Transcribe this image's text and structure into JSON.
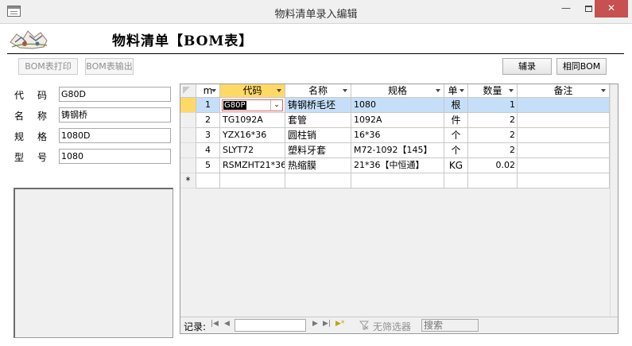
{
  "window": {
    "title": "物料清单录入编辑",
    "min_glyph": "—",
    "close_glyph": "✕"
  },
  "form": {
    "title": "物料清单【BOM表】"
  },
  "toolbar": {
    "print_label": "BOM表打印",
    "export_label": "BOM表输出",
    "assist_label": "辅录",
    "same_bom_label": "相同BOM"
  },
  "fields": [
    {
      "label": "代码",
      "value": "G80D"
    },
    {
      "label": "名称",
      "value": "铸钢桥"
    },
    {
      "label": "规格",
      "value": "1080D"
    },
    {
      "label": "型号",
      "value": "1080"
    }
  ],
  "grid": {
    "columns": [
      "m",
      "代码",
      "名称",
      "规格",
      "单",
      "数量",
      "备注"
    ],
    "rows": [
      {
        "n": "1",
        "code": "G80P",
        "name": "铸钢桥毛坯",
        "spec": "1080",
        "unit": "根",
        "qty": "1",
        "note": ""
      },
      {
        "n": "2",
        "code": "TG1092A",
        "name": "套管",
        "spec": "1092A",
        "unit": "件",
        "qty": "2",
        "note": ""
      },
      {
        "n": "3",
        "code": "YZX16*36",
        "name": "圆柱销",
        "spec": "16*36",
        "unit": "个",
        "qty": "2",
        "note": ""
      },
      {
        "n": "4",
        "code": "SLYT72",
        "name": "塑料牙套",
        "spec": "M72-1092【145】",
        "unit": "个",
        "qty": "2",
        "note": ""
      },
      {
        "n": "5",
        "code": "RSMZHT21*36",
        "name": "热缩膜",
        "spec": "21*36【中恒通】",
        "unit": "KG",
        "qty": "0.02",
        "note": ""
      }
    ],
    "current_row_marker": "",
    "new_row_marker": "*",
    "dropdown_glyph": "⌄"
  },
  "navigator": {
    "record_label": "记录:",
    "first_glyph": "|◀",
    "prev_glyph": "◀",
    "next_glyph": "▶",
    "last_glyph": "▶|",
    "new_glyph": "▶*",
    "record_value": "",
    "filter_label": "无筛选器",
    "search_placeholder": "搜索"
  }
}
